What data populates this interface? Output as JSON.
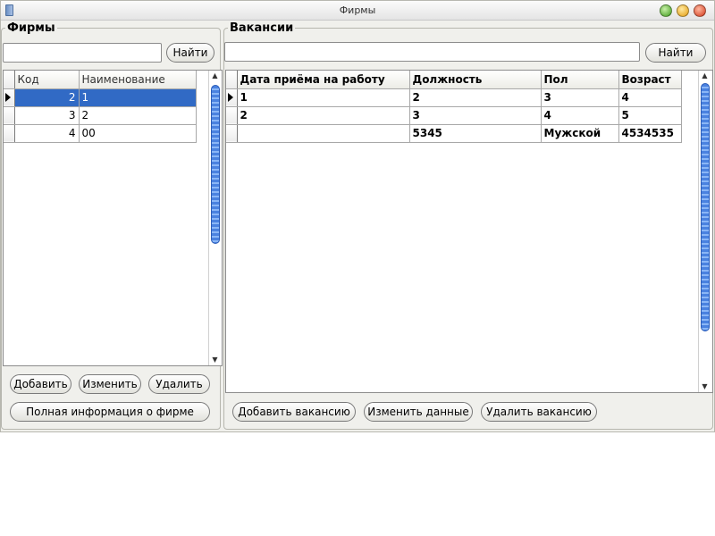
{
  "window": {
    "title": "Фирмы"
  },
  "firms": {
    "legend": "Фирмы",
    "search": {
      "value": "",
      "button_label": "Найти"
    },
    "columns": [
      "Код",
      "Наименование"
    ],
    "rows": [
      {
        "code": "2",
        "name": "1",
        "selected": true,
        "current": true
      },
      {
        "code": "3",
        "name": "2",
        "selected": false,
        "current": false
      },
      {
        "code": "4",
        "name": "00",
        "selected": false,
        "current": false
      }
    ],
    "buttons": {
      "add": "Добавить",
      "edit": "Изменить",
      "delete": "Удалить",
      "details": "Полная информация о фирме"
    }
  },
  "vacancies": {
    "legend": "Вакансии",
    "search": {
      "value": "",
      "button_label": "Найти"
    },
    "columns": [
      "Дата приёма на работу",
      "Должность",
      "Пол",
      "Возраст"
    ],
    "rows": [
      {
        "cells": [
          "1",
          "2",
          "3",
          "4"
        ],
        "current": true
      },
      {
        "cells": [
          "2",
          "3",
          "4",
          "5"
        ],
        "current": false
      },
      {
        "cells": [
          "",
          "5345",
          "Мужской",
          "4534535"
        ],
        "current": false
      }
    ],
    "buttons": {
      "add": "Добавить вакансию",
      "edit": "Изменить данные",
      "delete": "Удалить вакансию"
    }
  },
  "colors": {
    "selection": "#316ac5",
    "scroll_thumb": "#4a82e0"
  }
}
